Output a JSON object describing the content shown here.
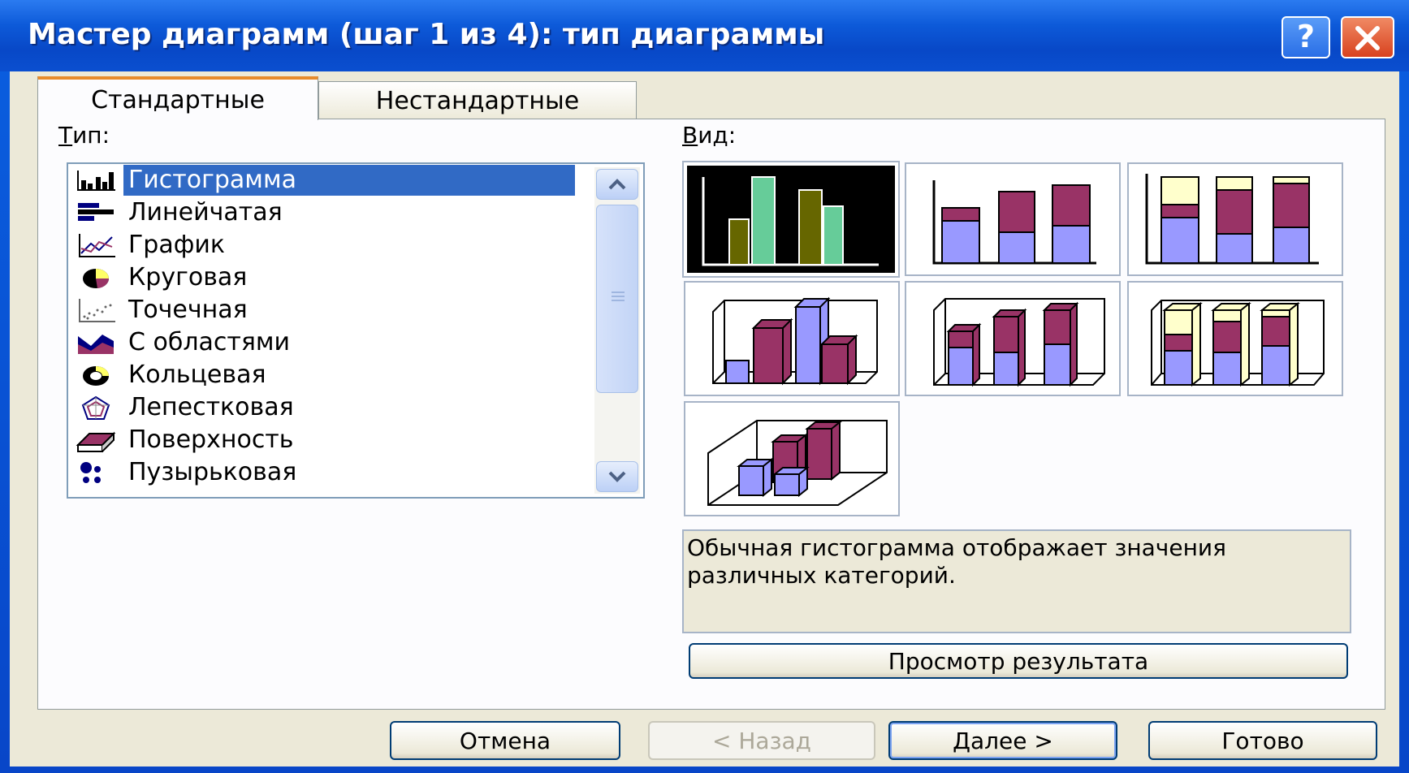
{
  "window": {
    "title": "Мастер диаграмм (шаг 1 из 4): тип диаграммы",
    "help_icon": "?",
    "close_icon": "✕"
  },
  "tabs": [
    {
      "label": "Стандартные",
      "active": true
    },
    {
      "label": "Нестандартные",
      "active": false
    }
  ],
  "type_panel": {
    "label": "Тип:",
    "items": [
      {
        "label": "Гистограмма",
        "icon": "column-chart-icon",
        "selected": true
      },
      {
        "label": "Линейчатая",
        "icon": "bar-chart-icon"
      },
      {
        "label": "График",
        "icon": "line-chart-icon"
      },
      {
        "label": "Круговая",
        "icon": "pie-chart-icon"
      },
      {
        "label": "Точечная",
        "icon": "scatter-chart-icon"
      },
      {
        "label": "С областями",
        "icon": "area-chart-icon"
      },
      {
        "label": "Кольцевая",
        "icon": "doughnut-chart-icon"
      },
      {
        "label": "Лепестковая",
        "icon": "radar-chart-icon"
      },
      {
        "label": "Поверхность",
        "icon": "surface-chart-icon"
      },
      {
        "label": "Пузырьковая",
        "icon": "bubble-chart-icon"
      }
    ]
  },
  "view_panel": {
    "label": "Вид:",
    "subtypes": [
      {
        "name": "clustered-column",
        "selected": true
      },
      {
        "name": "stacked-column"
      },
      {
        "name": "100-percent-stacked-column"
      },
      {
        "name": "3d-clustered-column"
      },
      {
        "name": "3d-stacked-column"
      },
      {
        "name": "3d-100-percent-stacked-column"
      },
      {
        "name": "3d-column"
      }
    ],
    "description": "Обычная гистограмма отображает значения различных категорий.",
    "preview_button": "Просмотр результата"
  },
  "buttons": {
    "cancel": "Отмена",
    "back": "< Назад",
    "next": "Далее >",
    "finish": "Готово"
  },
  "colors": {
    "selection": "#316ac5",
    "series1": "#9999ff",
    "series2": "#993366",
    "series3": "#ffffcc",
    "dark_bar": "#666600",
    "light_bar": "#66cc99"
  }
}
